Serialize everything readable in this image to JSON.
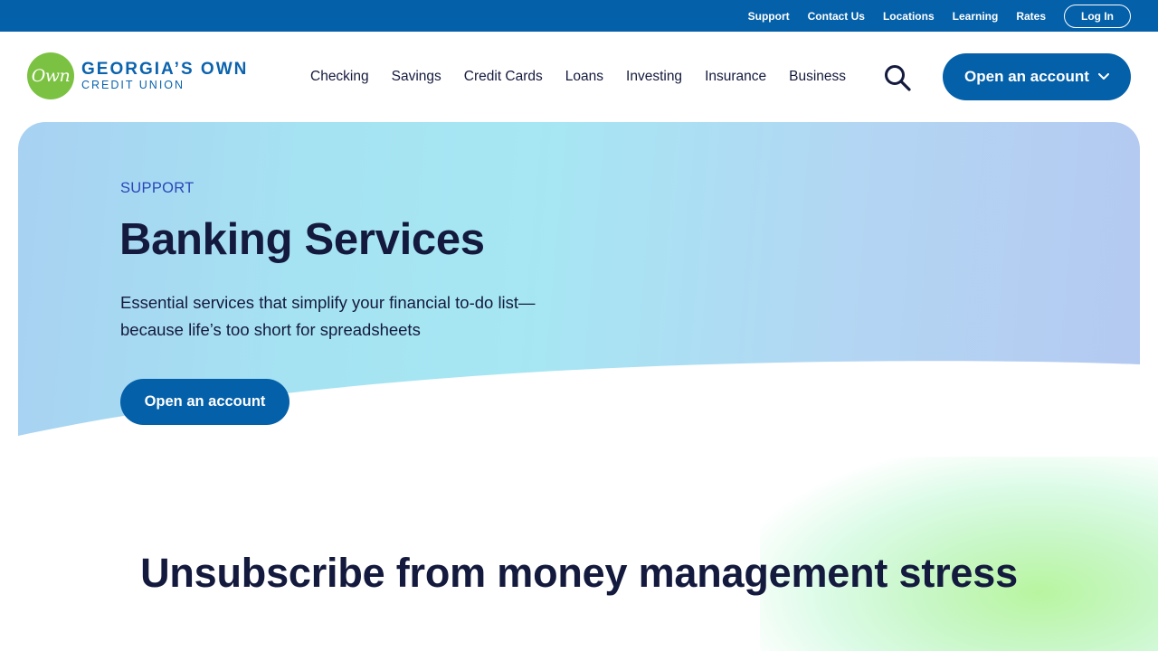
{
  "utility_nav": {
    "links": [
      "Support",
      "Contact Us",
      "Locations",
      "Learning",
      "Rates"
    ],
    "login_label": "Log In"
  },
  "logo": {
    "badge_text": "Own",
    "line1": "GEORGIA’S OWN",
    "line2": "CREDIT UNION"
  },
  "main_nav": {
    "items": [
      "Checking",
      "Savings",
      "Credit Cards",
      "Loans",
      "Investing",
      "Insurance",
      "Business"
    ],
    "cta_label": "Open an account"
  },
  "hero": {
    "eyebrow": "SUPPORT",
    "title": "Banking Services",
    "subtitle": "Essential services that simplify your financial to-do list—because life’s too short for spreadsheets",
    "cta_label": "Open an account"
  },
  "section": {
    "heading": "Unsubscribe from money management stress"
  },
  "colors": {
    "brand_blue": "#0460a9",
    "brand_green": "#7cc242",
    "text_dark": "#141a3d",
    "eyebrow": "#2a47b8"
  },
  "icons": {
    "search": "search-icon",
    "chevron": "chevron-down-icon"
  }
}
